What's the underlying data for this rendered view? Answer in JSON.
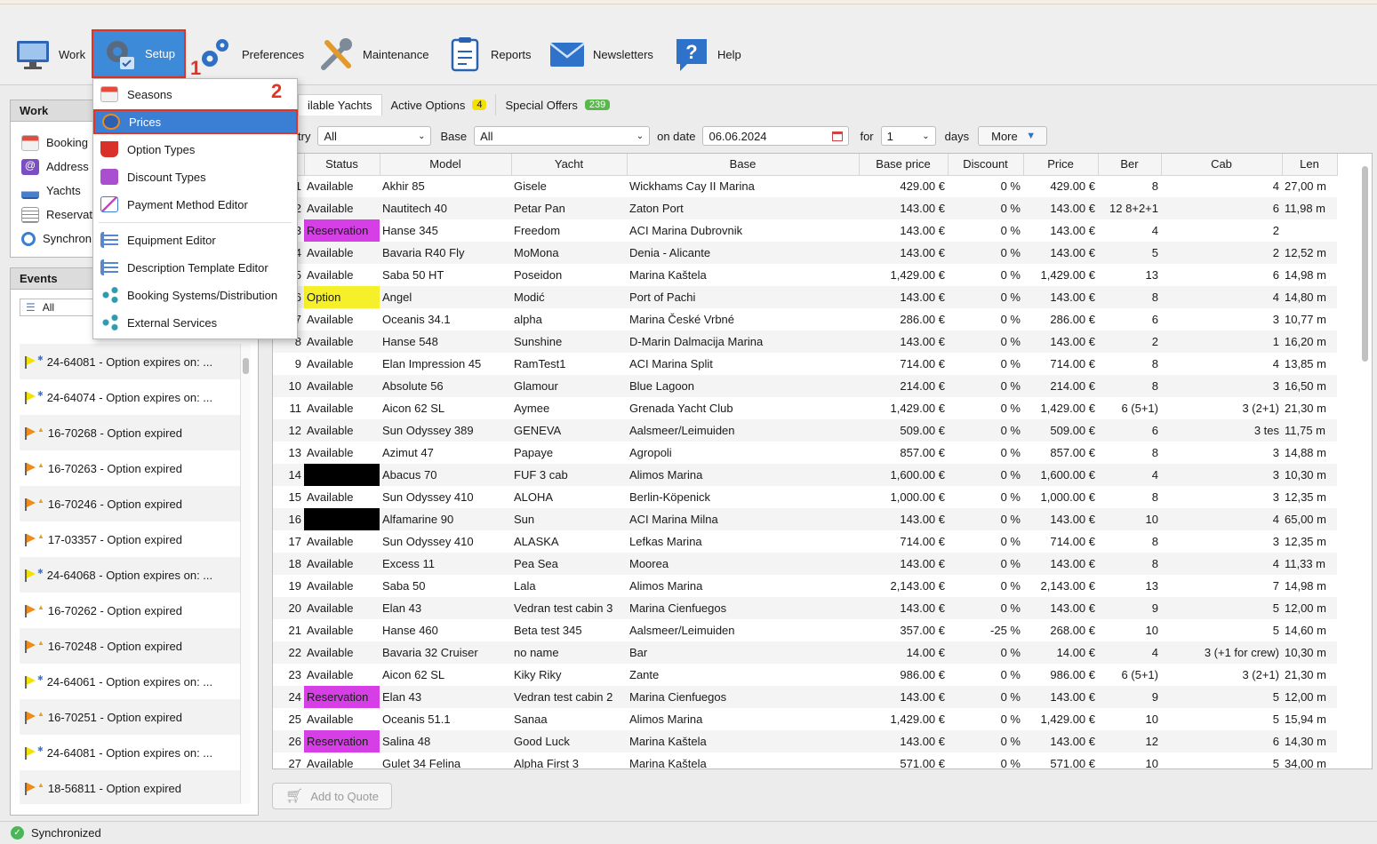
{
  "toolbar": {
    "work": "Work",
    "setup": "Setup",
    "preferences": "Preferences",
    "maintenance": "Maintenance",
    "reports": "Reports",
    "newsletters": "Newsletters",
    "help": "Help"
  },
  "steps": {
    "one": "1",
    "two": "2"
  },
  "setup_menu": [
    {
      "label": "Seasons",
      "icon": "calendar-icon"
    },
    {
      "label": "Prices",
      "icon": "price-tag-icon"
    },
    {
      "label": "Option Types",
      "icon": "basket-icon"
    },
    {
      "label": "Discount Types",
      "icon": "percent-icon"
    },
    {
      "label": "Payment Method Editor",
      "icon": "payment-icon"
    },
    {
      "label": "Equipment Editor",
      "icon": "list-icon"
    },
    {
      "label": "Description Template Editor",
      "icon": "list-icon"
    },
    {
      "label": "Booking Systems/Distribution",
      "icon": "share-icon"
    },
    {
      "label": "External Services",
      "icon": "share-icon"
    }
  ],
  "work_panel": {
    "title": "Work",
    "items": [
      "Booking",
      "Address",
      "Yachts",
      "Reservat",
      "Synchron"
    ]
  },
  "events_panel": {
    "title": "Events",
    "filter": "All",
    "items": [
      {
        "text": "24-64081 - Option expires on: ...",
        "flag": "yellow"
      },
      {
        "text": "24-64074 - Option expires on: ...",
        "flag": "yellow"
      },
      {
        "text": "16-70268 - Option expired",
        "flag": "orange"
      },
      {
        "text": "16-70263 - Option expired",
        "flag": "orange"
      },
      {
        "text": "16-70246 - Option expired",
        "flag": "orange"
      },
      {
        "text": "17-03357 - Option expired",
        "flag": "orange"
      },
      {
        "text": "24-64068 - Option expires on: ...",
        "flag": "yellow"
      },
      {
        "text": "16-70262 - Option expired",
        "flag": "orange"
      },
      {
        "text": "16-70248 - Option expired",
        "flag": "orange"
      },
      {
        "text": "24-64061 - Option expires on: ...",
        "flag": "yellow"
      },
      {
        "text": "16-70251 - Option expired",
        "flag": "orange"
      },
      {
        "text": "24-64081 - Option expires on: ...",
        "flag": "yellow"
      },
      {
        "text": "18-56811 - Option expired",
        "flag": "orange"
      }
    ]
  },
  "tabs": [
    {
      "label": "ilable Yachts",
      "count": ""
    },
    {
      "label": "Active Options",
      "count": "4",
      "color": "#f5e100"
    },
    {
      "label": "Special Offers",
      "count": "239",
      "color": "#58b84c"
    }
  ],
  "filters": {
    "country_label": "try",
    "country_value": "All",
    "base_label": "Base",
    "base_value": "All",
    "date_label": "on date",
    "date_value": "06.06.2024",
    "for_label": "for",
    "for_value": "1",
    "days_label": "days",
    "more": "More"
  },
  "table": {
    "columns": [
      "",
      "Status",
      "Model",
      "Yacht",
      "Base",
      "Base price",
      "Discount",
      "Price",
      "Ber",
      "Cab",
      "Len"
    ],
    "rows": [
      [
        "1",
        "Available",
        "Akhir 85",
        "Gisele",
        "Wickhams Cay II Marina",
        "429.00 €",
        "0 %",
        "429.00 €",
        "8",
        "4",
        "27,00 m"
      ],
      [
        "2",
        "Available",
        "Nautitech 40",
        "Petar Pan",
        "Zaton Port",
        "143.00 €",
        "0 %",
        "143.00 €",
        "12 8+2+1",
        "6",
        "11,98 m"
      ],
      [
        "3",
        "Reservation",
        "Hanse 345",
        "Freedom",
        "ACI Marina Dubrovnik",
        "143.00 €",
        "0 %",
        "143.00 €",
        "4",
        "2",
        ""
      ],
      [
        "4",
        "Available",
        "Bavaria R40 Fly",
        "MoMona",
        "Denia - Alicante",
        "143.00 €",
        "0 %",
        "143.00 €",
        "5",
        "2",
        "12,52 m"
      ],
      [
        "5",
        "Available",
        "Saba 50 HT",
        "Poseidon",
        "Marina Kaštela",
        "1,429.00 €",
        "0 %",
        "1,429.00 €",
        "13",
        "6",
        "14,98 m"
      ],
      [
        "6",
        "Option",
        "Angel",
        "Modić",
        "Port of Pachi",
        "143.00 €",
        "0 %",
        "143.00 €",
        "8",
        "4",
        "14,80 m"
      ],
      [
        "7",
        "Available",
        "Oceanis 34.1",
        "alpha",
        "Marina České Vrbné",
        "286.00 €",
        "0 %",
        "286.00 €",
        "6",
        "3",
        "10,77 m"
      ],
      [
        "8",
        "Available",
        "Hanse 548",
        "Sunshine",
        "D-Marin Dalmacija Marina",
        "143.00 €",
        "0 %",
        "143.00 €",
        "2",
        "1",
        "16,20 m"
      ],
      [
        "9",
        "Available",
        "Elan Impression 45",
        "RamTest1",
        "ACI Marina Split",
        "714.00 €",
        "0 %",
        "714.00 €",
        "8",
        "4",
        "13,85 m"
      ],
      [
        "10",
        "Available",
        "Absolute 56",
        "Glamour",
        "Blue Lagoon",
        "214.00 €",
        "0 %",
        "214.00 €",
        "8",
        "3",
        "16,50 m"
      ],
      [
        "11",
        "Available",
        "Aicon 62 SL",
        "Aymee",
        "Grenada Yacht Club",
        "1,429.00 €",
        "0 %",
        "1,429.00 €",
        "6 (5+1)",
        "3 (2+1)",
        "21,30 m"
      ],
      [
        "12",
        "Available",
        "Sun Odyssey 389",
        "GENEVA",
        "Aalsmeer/Leimuiden",
        "509.00 €",
        "0 %",
        "509.00 €",
        "6",
        "3 tes",
        "11,75 m"
      ],
      [
        "13",
        "Available",
        "Azimut 47",
        "Papaye",
        "Agropoli",
        "857.00 €",
        "0 %",
        "857.00 €",
        "8",
        "3",
        "14,88 m"
      ],
      [
        "14",
        "",
        "Abacus 70",
        "FUF 3 cab",
        "Alimos Marina",
        "1,600.00 €",
        "0 %",
        "1,600.00 €",
        "4",
        "3",
        "10,30 m"
      ],
      [
        "15",
        "Available",
        "Sun Odyssey 410",
        "ALOHA",
        "Berlin-Köpenick",
        "1,000.00 €",
        "0 %",
        "1,000.00 €",
        "8",
        "3",
        "12,35 m"
      ],
      [
        "16",
        "",
        "Alfamarine 90",
        "Sun",
        "ACI Marina Milna",
        "143.00 €",
        "0 %",
        "143.00 €",
        "10",
        "4",
        "65,00 m"
      ],
      [
        "17",
        "Available",
        "Sun Odyssey 410",
        "ALASKA",
        "Lefkas Marina",
        "714.00 €",
        "0 %",
        "714.00 €",
        "8",
        "3",
        "12,35 m"
      ],
      [
        "18",
        "Available",
        "Excess 11",
        "Pea Sea",
        "Moorea",
        "143.00 €",
        "0 %",
        "143.00 €",
        "8",
        "4",
        "11,33 m"
      ],
      [
        "19",
        "Available",
        "Saba 50",
        "Lala",
        "Alimos Marina",
        "2,143.00 €",
        "0 %",
        "2,143.00 €",
        "13",
        "7",
        "14,98 m"
      ],
      [
        "20",
        "Available",
        "Elan 43",
        "Vedran test cabin 3",
        "Marina Cienfuegos",
        "143.00 €",
        "0 %",
        "143.00 €",
        "9",
        "5",
        "12,00 m"
      ],
      [
        "21",
        "Available",
        "Hanse 460",
        "Beta test 345",
        "Aalsmeer/Leimuiden",
        "357.00 €",
        "-25 %",
        "268.00 €",
        "10",
        "5",
        "14,60 m"
      ],
      [
        "22",
        "Available",
        "Bavaria 32 Cruiser",
        "no name",
        "Bar",
        "14.00 €",
        "0 %",
        "14.00 €",
        "4",
        "3 (+1 for crew)",
        "10,30 m"
      ],
      [
        "23",
        "Available",
        "Aicon 62 SL",
        "Kiky Riky",
        "Zante",
        "986.00 €",
        "0 %",
        "986.00 €",
        "6 (5+1)",
        "3 (2+1)",
        "21,30 m"
      ],
      [
        "24",
        "Reservation",
        "Elan 43",
        "Vedran test cabin 2",
        "Marina Cienfuegos",
        "143.00 €",
        "0 %",
        "143.00 €",
        "9",
        "5",
        "12,00 m"
      ],
      [
        "25",
        "Available",
        "Oceanis 51.1",
        "Sanaa",
        "Alimos Marina",
        "1,429.00 €",
        "0 %",
        "1,429.00 €",
        "10",
        "5",
        "15,94 m"
      ],
      [
        "26",
        "Reservation",
        "Salina 48",
        "Good Luck",
        "Marina Kaštela",
        "143.00 €",
        "0 %",
        "143.00 €",
        "12",
        "6",
        "14,30 m"
      ],
      [
        "27",
        "Available",
        "Gulet 34 Felina",
        "Alpha First 3",
        "Marina Kaštela",
        "571.00 €",
        "0 %",
        "571.00 €",
        "10",
        "5",
        "34,00 m"
      ]
    ]
  },
  "add_to_quote": "Add to Quote",
  "status_bar": "Synchronized",
  "colors": {
    "accent": "#3b7fd4",
    "highlight_border": "#e53322",
    "reservation": "#d63ee6",
    "option": "#f5f02a"
  }
}
